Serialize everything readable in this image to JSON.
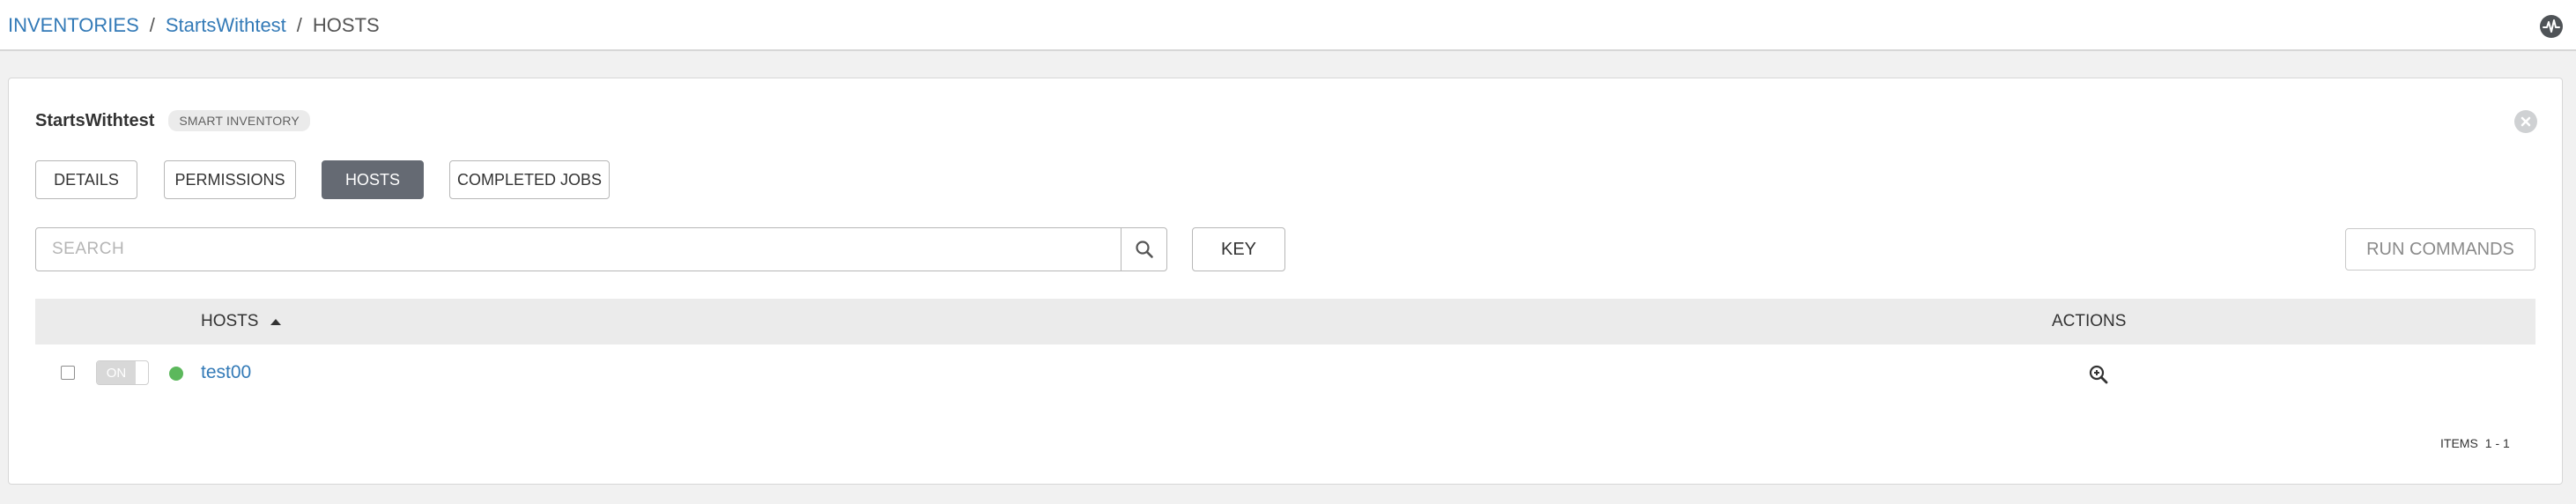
{
  "breadcrumb": {
    "items": [
      "INVENTORIES",
      "StartsWithtest"
    ],
    "separator": "/",
    "current": "HOSTS"
  },
  "header": {
    "activity_icon": "activity-stream-icon"
  },
  "panel": {
    "title": "StartsWithtest",
    "badge": "SMART INVENTORY",
    "close_icon": "close-icon"
  },
  "tabs": [
    {
      "label": "DETAILS",
      "active": false
    },
    {
      "label": "PERMISSIONS",
      "active": false
    },
    {
      "label": "HOSTS",
      "active": true
    },
    {
      "label": "COMPLETED JOBS",
      "active": false
    }
  ],
  "search": {
    "placeholder": "SEARCH",
    "value": "",
    "icon": "search-icon"
  },
  "key_button": "KEY",
  "run_commands_button": "RUN COMMANDS",
  "table": {
    "columns": [
      "HOSTS",
      "ACTIONS"
    ],
    "sort": "ascending",
    "rows": [
      {
        "toggle": "ON",
        "status": "ok",
        "name": "test00",
        "action_icon": "view-icon"
      }
    ]
  },
  "pagination": {
    "label": "ITEMS",
    "range": "1 - 1"
  },
  "colors": {
    "link": "#337ab7",
    "active_tab": "#656a73",
    "status_ok": "#5cb85c",
    "table_header": "#ebebeb"
  }
}
